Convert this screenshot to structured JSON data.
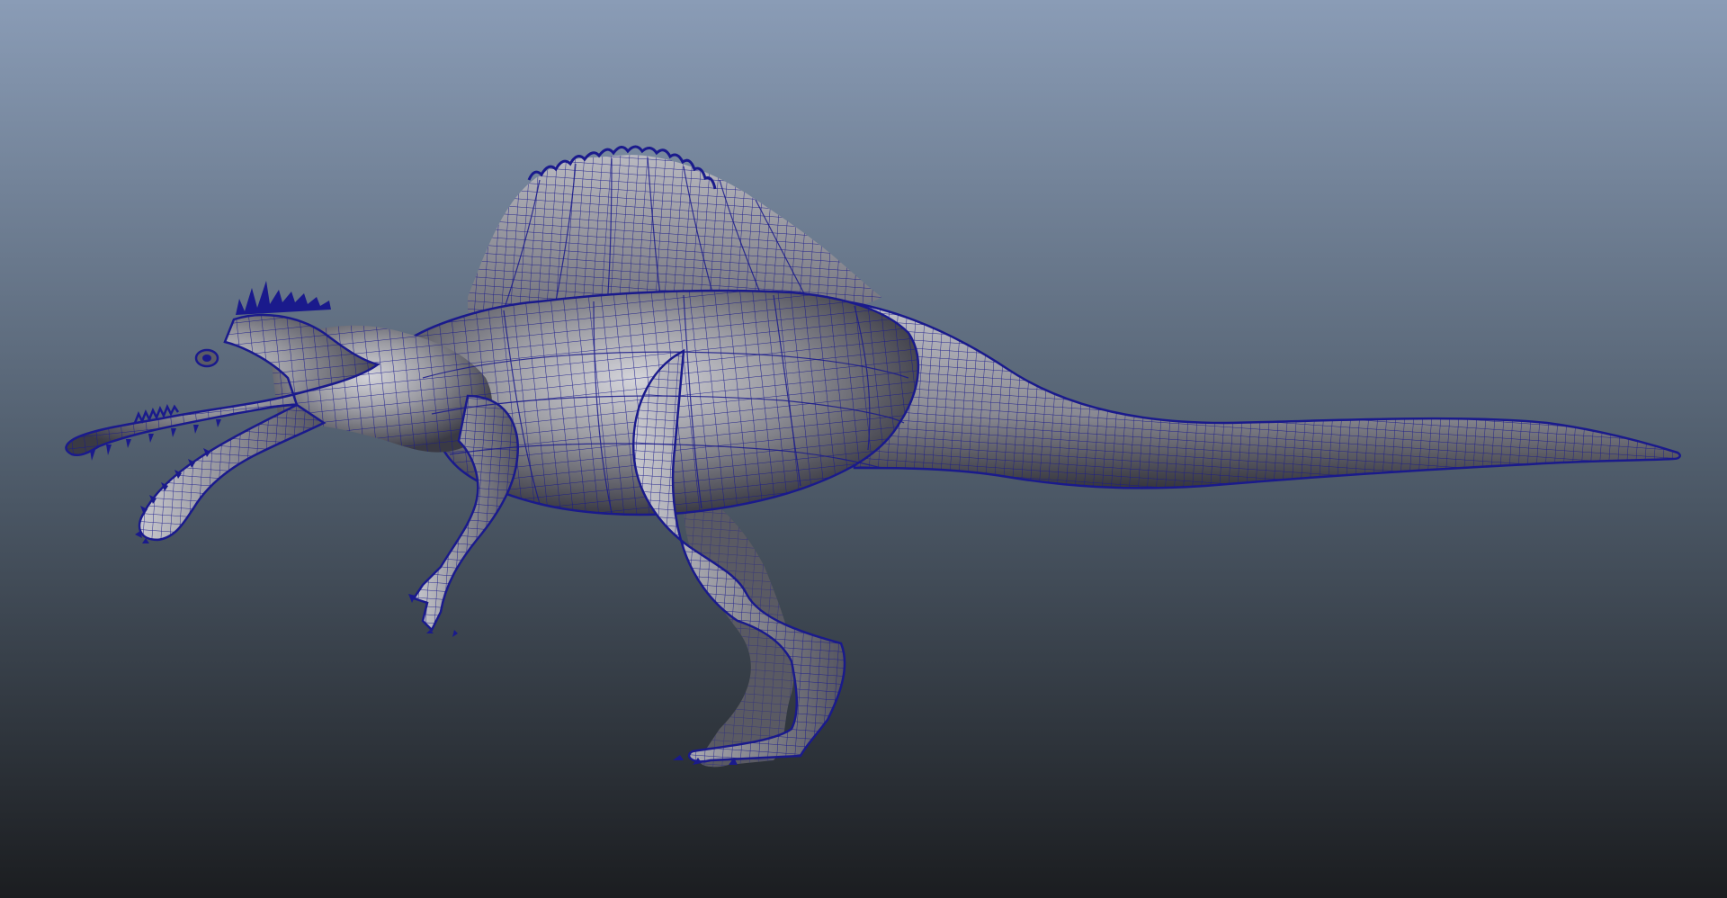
{
  "viewport": {
    "background_top_color": "#8a9cb6",
    "background_mid_color": "#4f5c6b",
    "background_bottom_color": "#1b1d20"
  },
  "model": {
    "subject": "spinosaurus-wireframe-mesh",
    "shading": "smooth-shaded-with-wireframe-on-shaded",
    "surface_color": "#9c9ca3",
    "highlight_color": "#d4d4da",
    "shadow_color": "#3a3a44",
    "wireframe_color": "#1a1a8c"
  }
}
